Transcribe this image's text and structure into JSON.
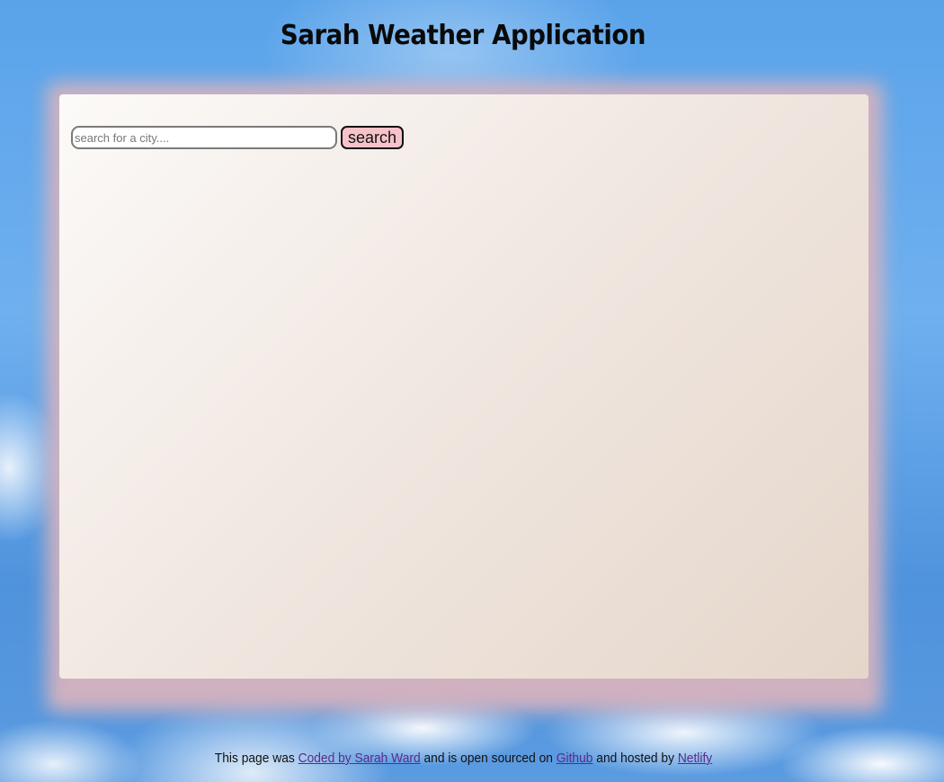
{
  "header": {
    "title": "Sarah Weather Application"
  },
  "search": {
    "placeholder": "search for a city....",
    "value": "",
    "button_label": "search"
  },
  "footer": {
    "text_1": "This page was ",
    "link_coded_by": "Coded by Sarah Ward",
    "text_2": " and is open sourced on ",
    "link_github": "Github",
    "text_3": " and hosted by ",
    "link_netlify": "Netlify"
  },
  "colors": {
    "sky": "#5aa3ea",
    "card_glow": "#d6b2be",
    "button_bg": "#f7c3c8",
    "link": "#5a2a8c"
  }
}
